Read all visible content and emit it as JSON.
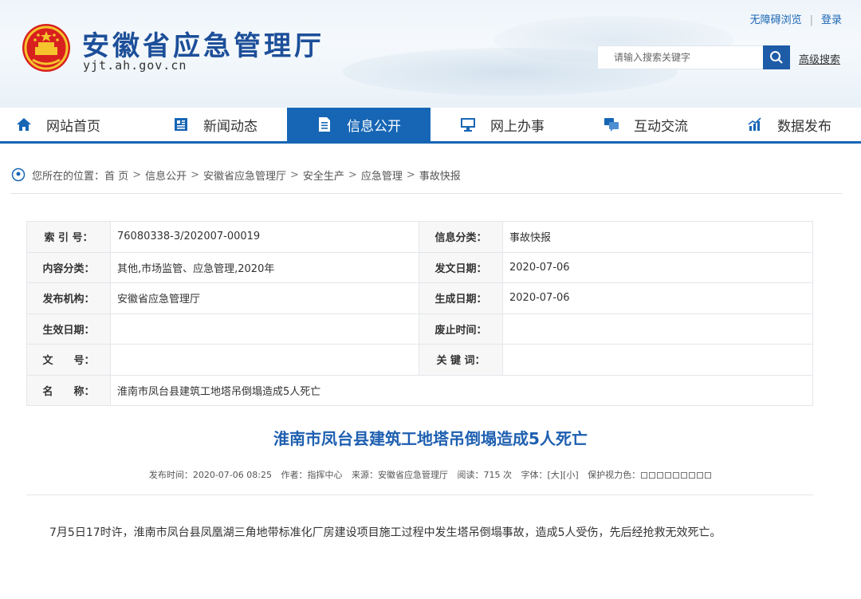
{
  "header": {
    "site_title": "安徽省应急管理厅",
    "site_url": "yjt.ah.gov.cn",
    "accessibility_link": "无障碍浏览",
    "login_link": "登录",
    "search_placeholder": "请输入搜索关键字",
    "advanced_search": "高级搜索"
  },
  "nav": {
    "items": [
      {
        "label": "网站首页",
        "icon": "home-icon"
      },
      {
        "label": "新闻动态",
        "icon": "newspaper-icon"
      },
      {
        "label": "信息公开",
        "icon": "document-icon"
      },
      {
        "label": "网上办事",
        "icon": "monitor-icon"
      },
      {
        "label": "互动交流",
        "icon": "chat-icon"
      },
      {
        "label": "数据发布",
        "icon": "chart-icon"
      }
    ],
    "active_index": 2,
    "accent_color": "#1766b5"
  },
  "breadcrumb": {
    "prefix": "您所在的位置：",
    "items": [
      "首 页",
      "信息公开",
      "安徽省应急管理厅",
      "安全生产",
      "应急管理",
      "事故快报"
    ]
  },
  "meta": {
    "index_label": "索 引 号：",
    "index_value": "76080338-3/202007-00019",
    "category_label": "信息分类：",
    "category_value": "事故快报",
    "content_label": "内容分类：",
    "content_value": "其他,市场监管、应急管理,2020年",
    "issue_date_label": "发文日期：",
    "issue_date_value": "2020-07-06",
    "publisher_label": "发布机构：",
    "publisher_value": "安徽省应急管理厅",
    "gen_date_label": "生成日期：",
    "gen_date_value": "2020-07-06",
    "effective_label": "生效日期：",
    "effective_value": "",
    "repeal_label": "废止时间：",
    "repeal_value": "",
    "doc_no_label": "文　　号：",
    "doc_no_value": "",
    "keywords_label": "关 键 词：",
    "keywords_value": "",
    "name_label": "名　　称：",
    "name_value": "淮南市凤台县建筑工地塔吊倒塌造成5人死亡"
  },
  "article": {
    "title": "淮南市凤台县建筑工地塔吊倒塌造成5人死亡",
    "publish_time": "发布时间：2020-07-06 08:25",
    "author": "作者：指挥中心",
    "source": "来源：安徽省应急管理厅",
    "views": "阅读：715 次",
    "font_label": "字体：",
    "font_large": "[大]",
    "font_small": "[小]",
    "eye_label": "保护视力色：",
    "body": "7月5日17时许，淮南市凤台县凤凰湖三角地带标准化厂房建设项目施工过程中发生塔吊倒塌事故，造成5人受伤，先后经抢救无效死亡。"
  }
}
